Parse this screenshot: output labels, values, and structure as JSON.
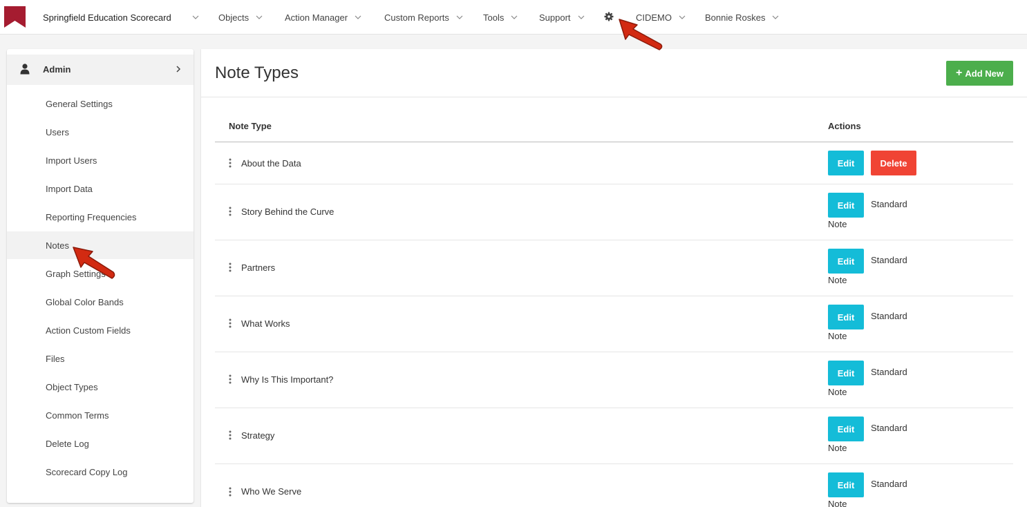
{
  "topnav": {
    "brand": "Springfield Education Scorecard",
    "items": [
      {
        "label": "Objects"
      },
      {
        "label": "Action Manager"
      },
      {
        "label": "Custom Reports"
      },
      {
        "label": "Tools"
      },
      {
        "label": "Support"
      }
    ],
    "org": "CIDEMO",
    "user": "Bonnie Roskes",
    "accent": "#a51c30"
  },
  "sidebar": {
    "section": "Admin",
    "items": [
      {
        "label": "General Settings"
      },
      {
        "label": "Users"
      },
      {
        "label": "Import Users"
      },
      {
        "label": "Import Data"
      },
      {
        "label": "Reporting Frequencies"
      },
      {
        "label": "Notes",
        "active": true
      },
      {
        "label": "Graph Settings"
      },
      {
        "label": "Global Color Bands"
      },
      {
        "label": "Action Custom Fields"
      },
      {
        "label": "Files"
      },
      {
        "label": "Object Types"
      },
      {
        "label": "Common Terms"
      },
      {
        "label": "Delete Log"
      },
      {
        "label": "Scorecard Copy Log"
      }
    ]
  },
  "main": {
    "title": "Note Types",
    "add_label": "Add New",
    "columns": {
      "name": "Note Type",
      "actions": "Actions"
    },
    "rows": [
      {
        "name": "About the Data",
        "edit": "Edit",
        "delete": "Delete"
      },
      {
        "name": "Story Behind the Curve",
        "edit": "Edit",
        "standard": "Standard",
        "note": "Note"
      },
      {
        "name": "Partners",
        "edit": "Edit",
        "standard": "Standard",
        "note": "Note"
      },
      {
        "name": "What Works",
        "edit": "Edit",
        "standard": "Standard",
        "note": "Note"
      },
      {
        "name": "Why Is This Important?",
        "edit": "Edit",
        "standard": "Standard",
        "note": "Note"
      },
      {
        "name": "Strategy",
        "edit": "Edit",
        "standard": "Standard",
        "note": "Note"
      },
      {
        "name": "Who We Serve",
        "edit": "Edit",
        "standard": "Standard",
        "note": "Note"
      }
    ]
  },
  "colors": {
    "add": "#4cae4c",
    "edit": "#14bcd8",
    "delete": "#f04434",
    "annotation_arrow": "#d22a12"
  }
}
